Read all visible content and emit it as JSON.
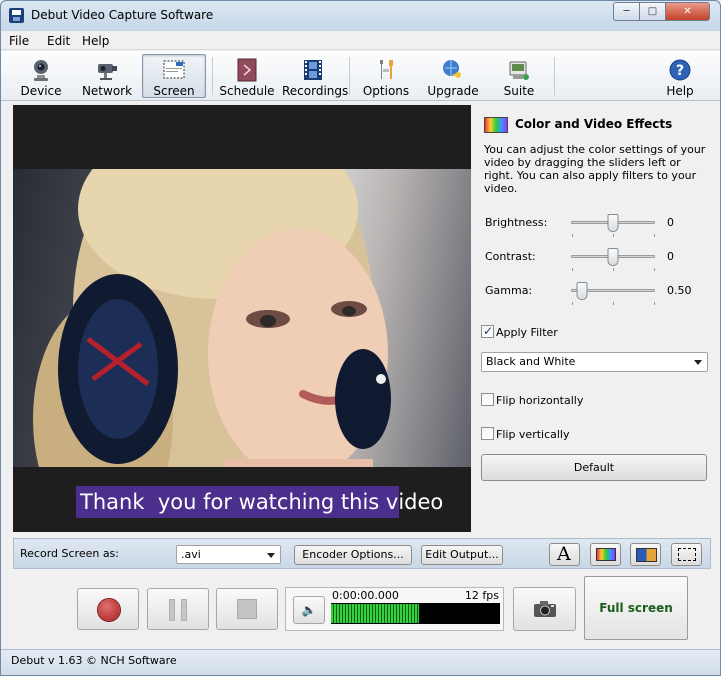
{
  "window": {
    "title": "Debut Video Capture Software",
    "minimize": "─",
    "maximize": "□",
    "close": "✕"
  },
  "menu": [
    "File",
    "Edit",
    "Help"
  ],
  "toolbar": [
    {
      "label": "Device",
      "icon": "webcam-icon"
    },
    {
      "label": "Network",
      "icon": "network-camera-icon"
    },
    {
      "label": "Screen",
      "icon": "screen-icon",
      "active": true
    },
    {
      "label": "Schedule",
      "icon": "schedule-icon"
    },
    {
      "label": "Recordings",
      "icon": "film-strip-icon"
    },
    {
      "label": "Options",
      "icon": "tools-icon"
    },
    {
      "label": "Upgrade",
      "icon": "globe-key-icon"
    },
    {
      "label": "Suite",
      "icon": "suite-icon"
    },
    {
      "label": "Help",
      "icon": "help-icon"
    }
  ],
  "video": {
    "caption": "Thank  you for watching this video"
  },
  "effects": {
    "title": "Color and Video Effects",
    "description": "You can adjust the color settings of your video by dragging the sliders left or right. You can also apply filters to your video.",
    "sliders": [
      {
        "label": "Brightness:",
        "value": "0",
        "level": 0.5
      },
      {
        "label": "Contrast:",
        "value": "0",
        "level": 0.5
      },
      {
        "label": "Gamma:",
        "value": "0.50",
        "level": 0.12
      }
    ],
    "apply_filter": {
      "label": "Apply Filter",
      "checked": true
    },
    "filter_value": "Black and White",
    "flip_horizontal": {
      "label": "Flip horizontally",
      "checked": false
    },
    "flip_vertical": {
      "label": "Flip vertically",
      "checked": false
    },
    "default_label": "Default"
  },
  "record": {
    "label": "Record Screen as:",
    "format": ".avi",
    "encoder_options": "Encoder Options...",
    "edit_output": "Edit Output..."
  },
  "controls": {
    "time": "0:00:00.000",
    "fps": "12 fps",
    "meter_level": 0.52,
    "fullscreen": "Full screen"
  },
  "status": "Debut v 1.63 © NCH Software"
}
